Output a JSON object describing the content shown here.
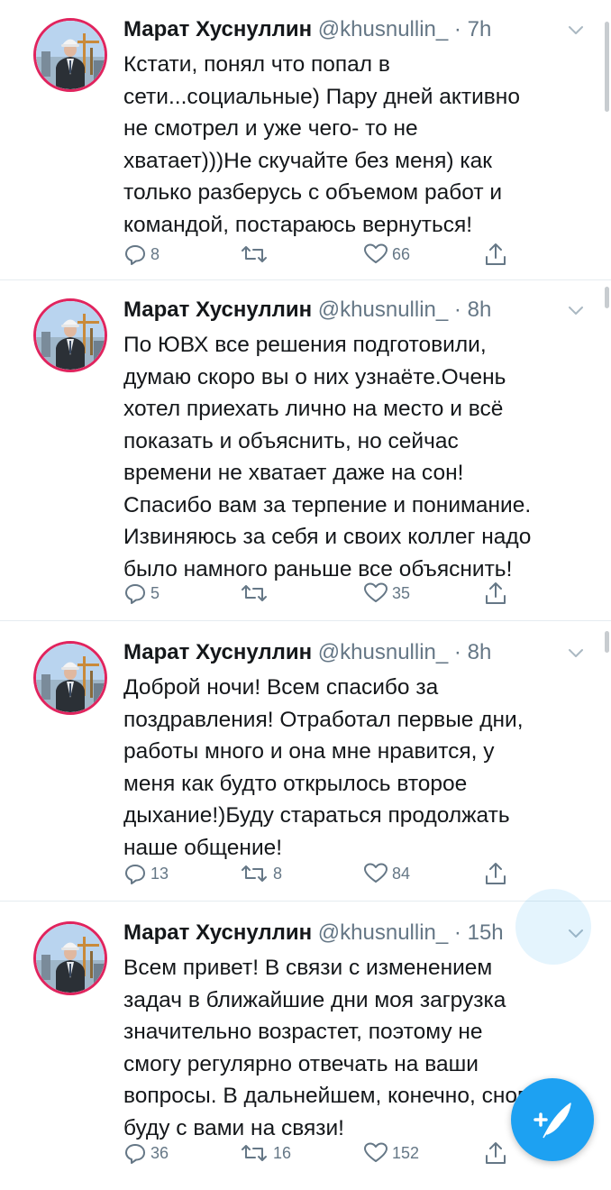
{
  "colors": {
    "accent": "#1da1f2",
    "muted": "#657786",
    "text": "#14171a",
    "avatar_ring": "#e0245e"
  },
  "icons": {
    "reply": "reply-icon",
    "retweet": "retweet-icon",
    "like": "heart-icon",
    "share": "share-icon",
    "menu": "chevron-down-icon",
    "compose": "compose-tweet-icon"
  },
  "tweets": [
    {
      "name": "Марат Хуснуллин",
      "handle": "@khusnullin_",
      "sep": "·",
      "time": "7h",
      "lines": [
        "Кстати, понял что попал в",
        "сети...социальные) Пару дней активно",
        "не смотрел и уже чего- то не",
        "хватает)))Не скучайте без меня) как",
        "только разберусь с объемом работ и",
        "командой, постараюсь вернуться!"
      ],
      "replies": "8",
      "retweets": "",
      "likes": "66"
    },
    {
      "name": "Марат Хуснуллин",
      "handle": "@khusnullin_",
      "sep": "·",
      "time": "8h",
      "lines": [
        "По ЮВХ все решения подготовили,",
        "думаю скоро вы о них узнаёте.Очень",
        "хотел приехать лично на место и всё",
        "показать и объяснить, но сейчас",
        "времени не хватает даже на сон!",
        "Спасибо вам за терпение и понимание.",
        "Извиняюсь за себя и своих коллег надо",
        "было намного раньше все объяснить!"
      ],
      "replies": "5",
      "retweets": "",
      "likes": "35"
    },
    {
      "name": "Марат Хуснуллин",
      "handle": "@khusnullin_",
      "sep": "·",
      "time": "8h",
      "lines": [
        "Доброй ночи! Всем спасибо за",
        "поздравления! Отработал первые дни,",
        "работы много и она мне нравится, у",
        "меня как будто открылось второе",
        "дыхание!)Буду стараться продолжать",
        "наше общение!"
      ],
      "replies": "13",
      "retweets": "8",
      "likes": "84"
    },
    {
      "name": "Марат Хуснуллин",
      "handle": "@khusnullin_",
      "sep": "·",
      "time": "15h",
      "lines": [
        "Всем привет! В связи с изменением",
        "задач в ближайшие дни моя загрузка",
        "значительно возрастет, поэтому не",
        "смогу регулярно отвечать на ваши",
        "вопросы. В дальнейшем, конечно, снова",
        "буду с вами на связи!"
      ],
      "replies": "36",
      "retweets": "16",
      "likes": "152"
    }
  ]
}
